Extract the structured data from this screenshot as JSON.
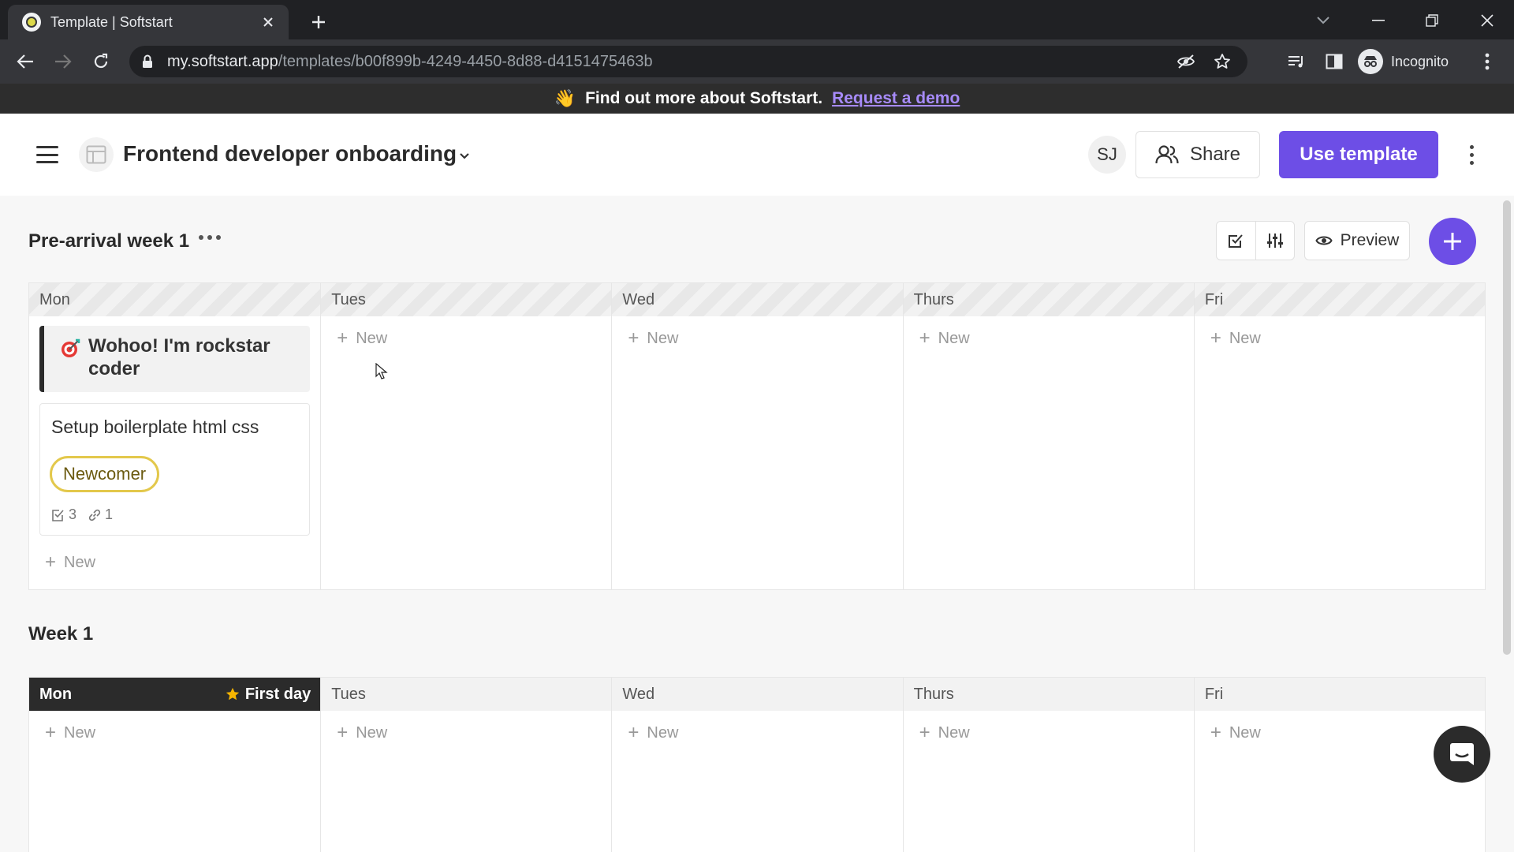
{
  "browser": {
    "tab_title": "Template | Softstart",
    "url_host": "my.softstart.app",
    "url_path": "/templates/b00f899b-4249-4450-8d88-d4151475463b",
    "profile_label": "Incognito"
  },
  "banner": {
    "message": "Find out more about Softstart.",
    "link_text": "Request a demo"
  },
  "header": {
    "title": "Frontend developer onboarding",
    "avatar_initials": "SJ",
    "share_label": "Share",
    "use_template_label": "Use template"
  },
  "toolbar": {
    "preview_label": "Preview"
  },
  "sections": [
    {
      "title": "Pre-arrival week 1",
      "columns": [
        {
          "day": "Mon",
          "new_label": "New",
          "milestone": "Wohoo! I'm rockstar coder",
          "task": {
            "title": "Setup boilerplate html css",
            "tag": "Newcomer",
            "checklist_count": "3",
            "link_count": "1"
          }
        },
        {
          "day": "Tues",
          "new_label": "New"
        },
        {
          "day": "Wed",
          "new_label": "New"
        },
        {
          "day": "Thurs",
          "new_label": "New"
        },
        {
          "day": "Fri",
          "new_label": "New"
        }
      ]
    },
    {
      "title": "Week 1",
      "columns": [
        {
          "day": "Mon",
          "badge": "First day",
          "new_label": "New"
        },
        {
          "day": "Tues",
          "new_label": "New"
        },
        {
          "day": "Wed",
          "new_label": "New"
        },
        {
          "day": "Thurs",
          "new_label": "New"
        },
        {
          "day": "Fri",
          "new_label": "New"
        }
      ]
    }
  ],
  "colors": {
    "accent": "#6d4ee6",
    "banner_bg": "#2d2d2d",
    "link": "#a78bfa",
    "tag_border": "#e3c84b"
  },
  "icons": {
    "banner": "waving-hand-icon",
    "milestone": "target-icon",
    "header_left": "hamburger-icon",
    "template": "layout-icon"
  }
}
